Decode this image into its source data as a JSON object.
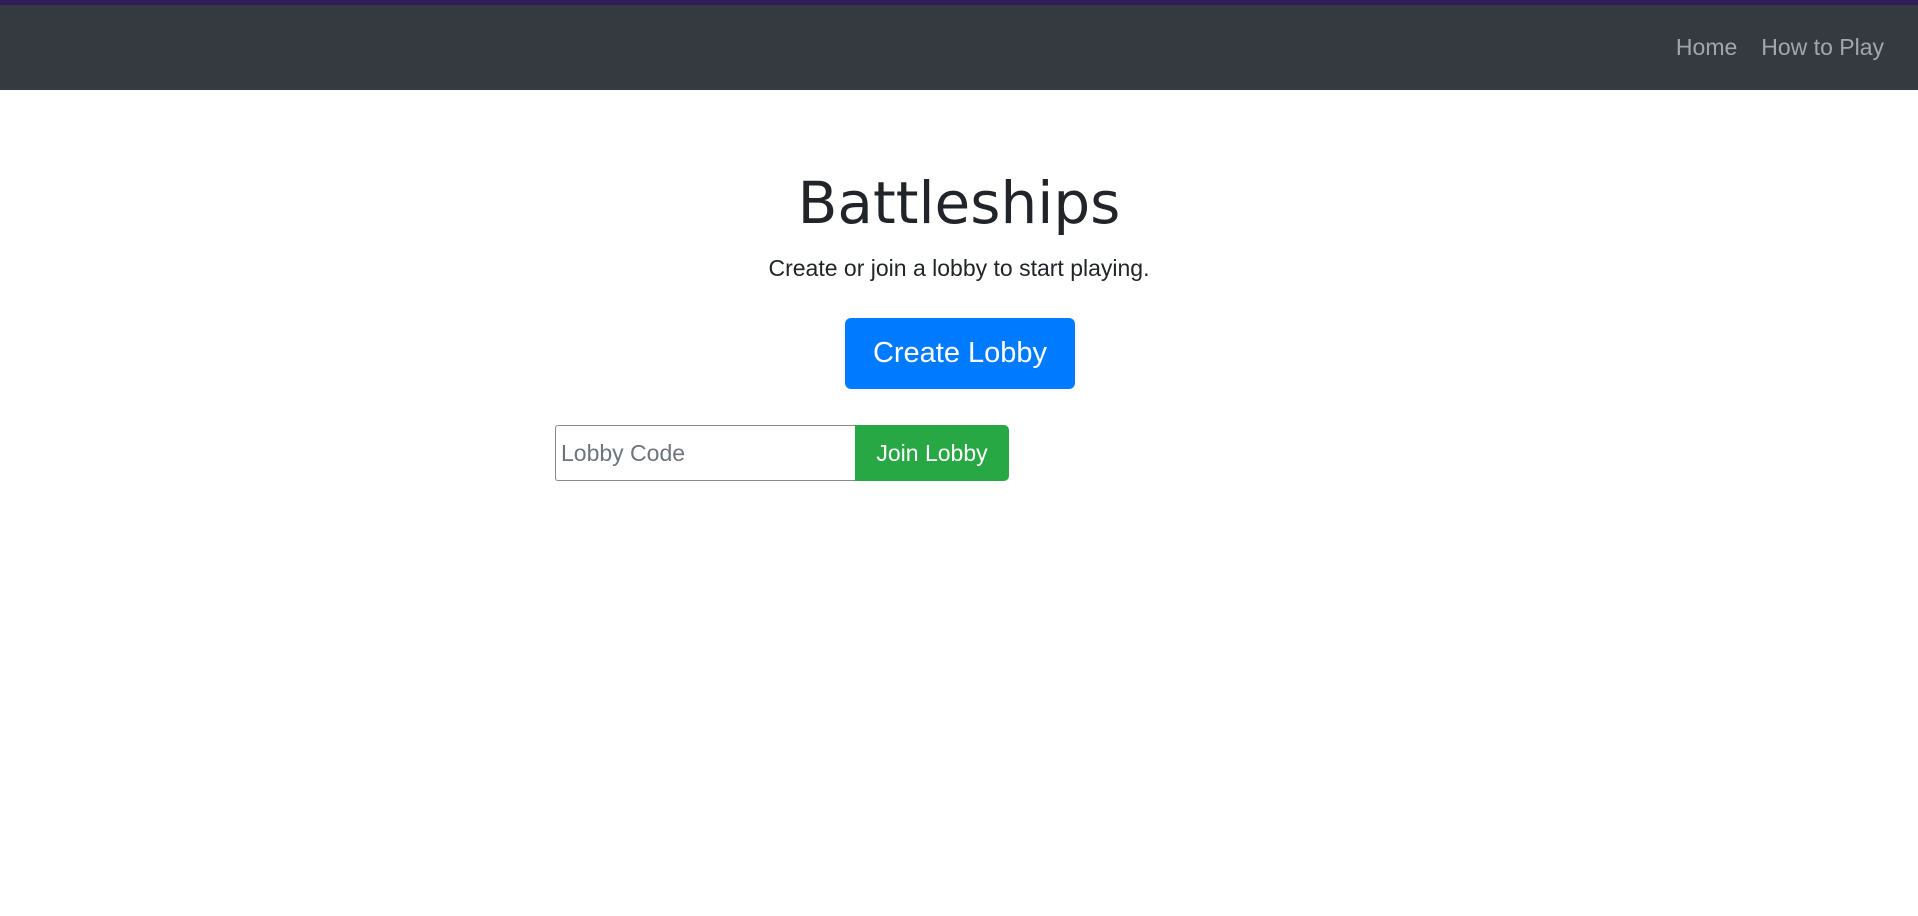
{
  "nav": {
    "items": [
      {
        "label": "Home"
      },
      {
        "label": "How to Play"
      }
    ]
  },
  "hero": {
    "title": "Battleships",
    "subtitle": "Create or join a lobby to start playing."
  },
  "lobby": {
    "create_label": "Create Lobby",
    "code_placeholder": "Lobby Code",
    "code_value": "",
    "join_label": "Join Lobby"
  },
  "colors": {
    "navbar_bg": "#343a40",
    "accent_strip": "#2f1d55",
    "primary": "#007bff",
    "success": "#28a745"
  }
}
